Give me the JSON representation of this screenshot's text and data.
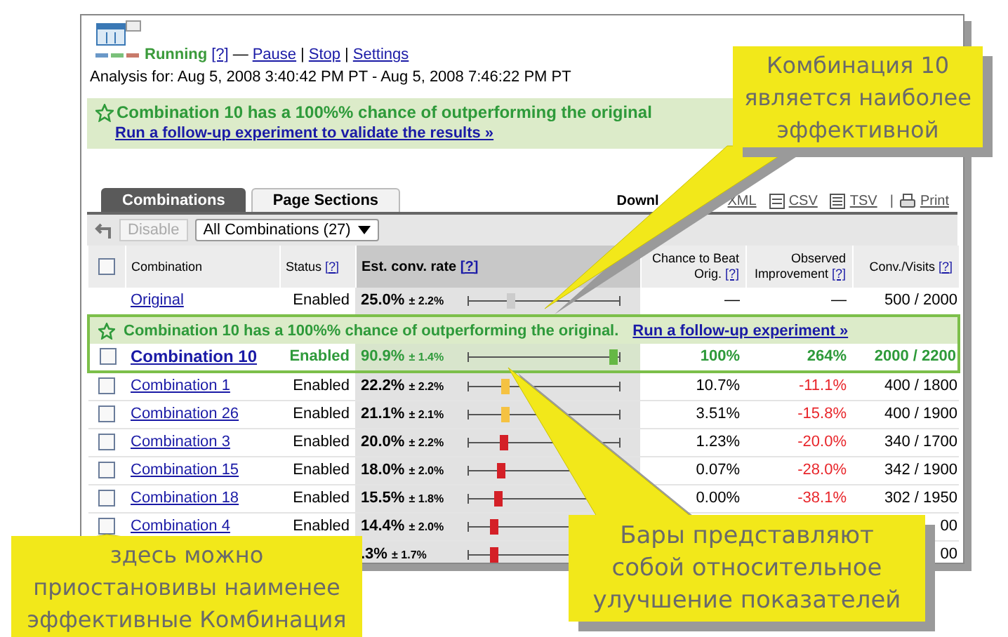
{
  "header": {
    "status": "Running",
    "help": "[?]",
    "dash": "—",
    "links": [
      {
        "label": "Pause"
      },
      {
        "label": "Stop"
      },
      {
        "label": "Settings"
      }
    ],
    "separator": "|",
    "analysis": "Analysis for: Aug 5, 2008 3:40:42 PM PT - Aug 5, 2008 7:46:22 PM PT"
  },
  "banner": {
    "message": "Combination 10 has a 100%% chance of outperforming the original",
    "link": "Run a follow-up experiment to validate the results »"
  },
  "tabs": [
    {
      "label": "Combinations",
      "selected": true
    },
    {
      "label": "Page Sections",
      "selected": false
    }
  ],
  "downloads": {
    "label": "Downl",
    "links": [
      {
        "kind": "xml",
        "label": "XML"
      },
      {
        "kind": "csv",
        "label": "CSV"
      },
      {
        "kind": "tsv",
        "label": "TSV"
      },
      {
        "kind": "print",
        "label": "Print"
      }
    ],
    "separator": "|"
  },
  "toolbar": {
    "button": {
      "label": "Disable",
      "disabled": true
    },
    "filter": "All Combinations (27)"
  },
  "table": {
    "select_all": {
      "checked": false
    },
    "columns": [
      {
        "label": "Combination"
      },
      {
        "label": "Status",
        "help": "[?]"
      },
      {
        "label": "Est. conv. rate",
        "help": "[?]"
      },
      {
        "label": "Chance to Beat Orig.",
        "help": "[?]"
      },
      {
        "label": "Observed Improvement",
        "help": "[?]"
      },
      {
        "label": "Conv./Visits",
        "help": "[?]"
      }
    ],
    "rows": [
      {
        "kind": "row",
        "name": "Original",
        "status": "Enabled",
        "rate": "25.0%",
        "error": "± 2.2%",
        "level": 0.27,
        "color": "#cccccc",
        "chance": "—",
        "improvement": "—",
        "negative": false,
        "conversions": "500 / 2000",
        "winner": false
      },
      {
        "kind": "banner",
        "message": "Combination 10 has a 100%% chance of outperforming the original.",
        "link": "Run a follow-up experiment »"
      },
      {
        "kind": "row",
        "checked": false,
        "name": "Combination 10",
        "status": "Enabled",
        "rate": "90.9%",
        "error": "± 1.4%",
        "level": 0.98,
        "color": "#66b845",
        "chance": "100%",
        "improvement": "264%",
        "negative": false,
        "conversions": "2000 / 2200",
        "winner": true
      },
      {
        "kind": "row",
        "checked": false,
        "name": "Combination 1",
        "status": "Enabled",
        "rate": "22.2%",
        "error": "± 2.2%",
        "level": 0.23,
        "color": "#f5c242",
        "chance": "10.7%",
        "improvement": "-11.1%",
        "negative": true,
        "conversions": "400 / 1800",
        "winner": false
      },
      {
        "kind": "row",
        "checked": false,
        "name": "Combination 26",
        "status": "Enabled",
        "rate": "21.1%",
        "error": "± 2.1%",
        "level": 0.23,
        "color": "#f5c242",
        "chance": "3.51%",
        "improvement": "-15.8%",
        "negative": true,
        "conversions": "400 / 1900",
        "winner": false
      },
      {
        "kind": "row",
        "checked": false,
        "name": "Combination 3",
        "status": "Enabled",
        "rate": "20.0%",
        "error": "± 2.2%",
        "level": 0.22,
        "color": "#d42027",
        "chance": "1.23%",
        "improvement": "-20.0%",
        "negative": true,
        "conversions": "340 / 1700",
        "winner": false
      },
      {
        "kind": "row",
        "checked": false,
        "name": "Combination 15",
        "status": "Enabled",
        "rate": "18.0%",
        "error": "± 2.0%",
        "level": 0.2,
        "color": "#d42027",
        "chance": "0.07%",
        "improvement": "-28.0%",
        "negative": true,
        "conversions": "342 / 1900",
        "winner": false
      },
      {
        "kind": "row",
        "checked": false,
        "name": "Combination 18",
        "status": "Enabled",
        "rate": "15.5%",
        "error": "± 1.8%",
        "level": 0.18,
        "color": "#d42027",
        "chance": "0.00%",
        "improvement": "-38.1%",
        "negative": true,
        "conversions": "302 / 1950",
        "winner": false
      },
      {
        "kind": "row",
        "checked": false,
        "name": "Combination 4",
        "status": "Enabled",
        "rate": "14.4%",
        "error": "± 2.0%",
        "level": 0.16,
        "color": "#d42027",
        "conversions": "00",
        "winner": false
      },
      {
        "kind": "row",
        "rate": ".3%",
        "error": "± 1.7%",
        "level": 0.16,
        "color": "#d42027",
        "conversions": "00",
        "winner": false
      }
    ]
  },
  "callouts": [
    {
      "lines": [
        "Комбинация 10",
        "является наиболее",
        "эффективной"
      ]
    },
    {
      "lines": [
        "Бары представляют",
        "собой относительное",
        "улучшение показателей"
      ]
    },
    {
      "lines": [
        "здесь можно",
        "приостановивы наименее",
        "эффективные Комбинация"
      ]
    }
  ]
}
